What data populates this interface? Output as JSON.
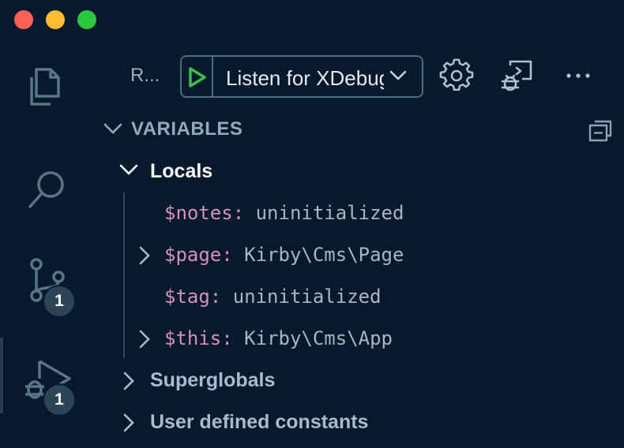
{
  "toolbar": {
    "run_label": "R...",
    "config_selected": "Listen for XDebug"
  },
  "activity_bar": {
    "items": [
      {
        "icon": "files-icon"
      },
      {
        "icon": "search-icon"
      },
      {
        "icon": "source-control-icon",
        "badge": "1"
      },
      {
        "icon": "run-debug-icon",
        "badge": "1"
      }
    ]
  },
  "variables": {
    "title": "VARIABLES",
    "locals": {
      "label": "Locals",
      "items": [
        {
          "name": "$notes",
          "sep": ": ",
          "value": "uninitialized",
          "expandable": false
        },
        {
          "name": "$page",
          "sep": ": ",
          "value": "Kirby\\Cms\\Page",
          "expandable": true
        },
        {
          "name": "$tag",
          "sep": ": ",
          "value": "uninitialized",
          "expandable": false
        },
        {
          "name": "$this",
          "sep": ": ",
          "value": "Kirby\\Cms\\App",
          "expandable": true
        }
      ]
    },
    "superglobals": {
      "label": "Superglobals"
    },
    "user_constants": {
      "label": "User defined constants"
    }
  },
  "colors": {
    "background": "#071a2c",
    "variable_name": "#d58fc4",
    "variable_value": "#a9b5c2",
    "play_green": "#3fb950",
    "badge": "#2f4356"
  }
}
